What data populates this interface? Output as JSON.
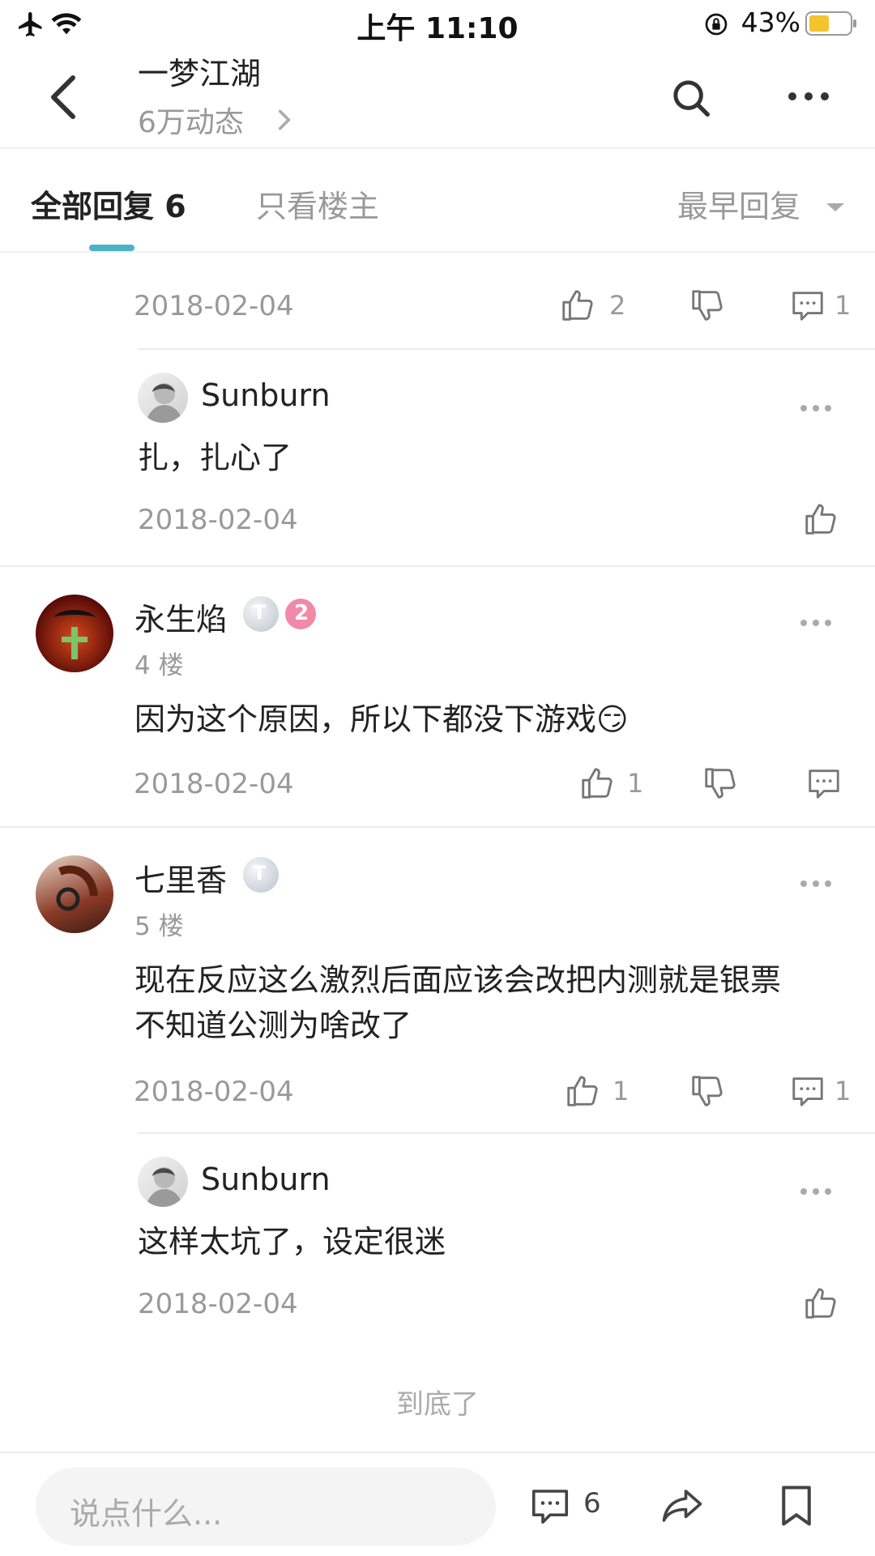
{
  "status_bar": {
    "time": "上午 11:10",
    "battery_percent": "43%",
    "icons": [
      "airplane-icon",
      "wifi-icon",
      "orientation-lock-icon",
      "battery-icon"
    ]
  },
  "header": {
    "title": "一梦江湖",
    "subtitle": "6万动态",
    "icons": [
      "back-icon",
      "chevron-right-icon",
      "search-icon",
      "more-icon"
    ]
  },
  "tabs": {
    "all_label": "全部回复 6",
    "op_only_label": "只看楼主",
    "sort_label": "最早回复"
  },
  "replies": [
    {
      "date": "2018-02-04",
      "likes": "2",
      "comments": "1",
      "subreplies": [
        {
          "user": "Sunburn",
          "text": "扎，扎心了",
          "date": "2018-02-04"
        }
      ]
    },
    {
      "user": "永生焰",
      "floor": "4 楼",
      "text": "因为这个原因，所以下都没下游戏😏",
      "date": "2018-02-04",
      "likes": "1",
      "level_badge": "2"
    },
    {
      "user": "七里香",
      "floor": "5 楼",
      "text_line1": "现在反应这么激烈后面应该会改把内测就是银票",
      "text_line2": "不知道公测为啥改了",
      "date": "2018-02-04",
      "likes": "1",
      "comments": "1",
      "subreplies": [
        {
          "user": "Sunburn",
          "text": "这样太坑了，设定很迷",
          "date": "2018-02-04"
        }
      ]
    }
  ],
  "end_text": "到底了",
  "bottom_bar": {
    "input_placeholder": "说点什么...",
    "comment_count": "6",
    "icons": [
      "comment-icon",
      "share-icon",
      "bookmark-icon"
    ]
  },
  "colors": {
    "accent": "#4bb3c3",
    "text_primary": "#222222",
    "text_secondary": "#999999"
  }
}
